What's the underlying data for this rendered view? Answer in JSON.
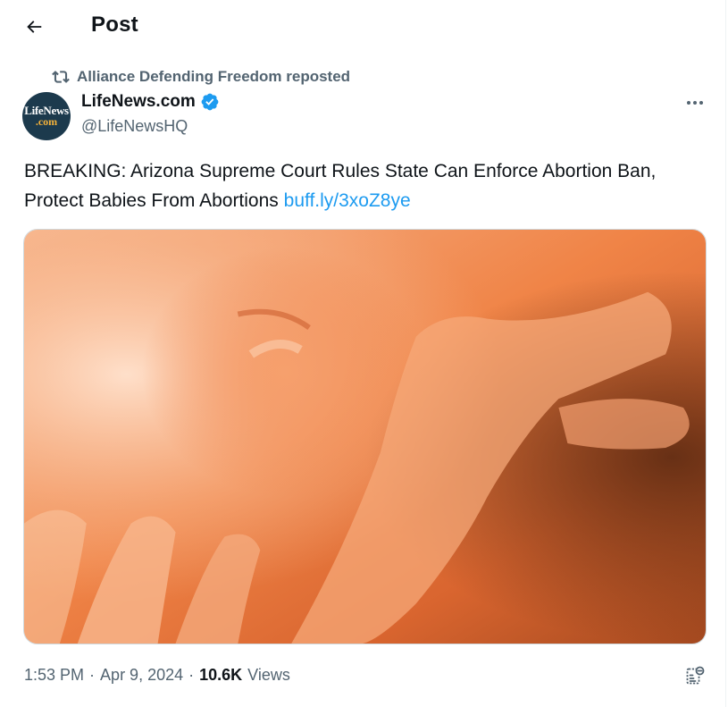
{
  "header": {
    "title": "Post"
  },
  "repost": {
    "text": "Alliance Defending Freedom reposted"
  },
  "author": {
    "name": "LifeNews.com",
    "handle": "@LifeNewsHQ",
    "avatar_line1": "LifeNews",
    "avatar_line2": ".com",
    "verified": true
  },
  "post": {
    "text": "BREAKING: Arizona Supreme Court Rules State Can Enforce Abortion Ban, Protect Babies From Abortions ",
    "link": "buff.ly/3xoZ8ye"
  },
  "meta": {
    "time": "1:53 PM",
    "sep1": "·",
    "date": "Apr 9, 2024",
    "sep2": "·",
    "views_count": "10.6K",
    "views_label": "Views"
  },
  "icons": {
    "back": "arrow-left-icon",
    "repost": "repost-icon",
    "verified": "verified-badge-icon",
    "more": "more-horizontal-icon",
    "analytics": "analytics-icon"
  },
  "colors": {
    "link": "#1d9bf0",
    "secondary_text": "#536471",
    "primary_text": "#0f1419",
    "verified": "#1d9bf0"
  }
}
